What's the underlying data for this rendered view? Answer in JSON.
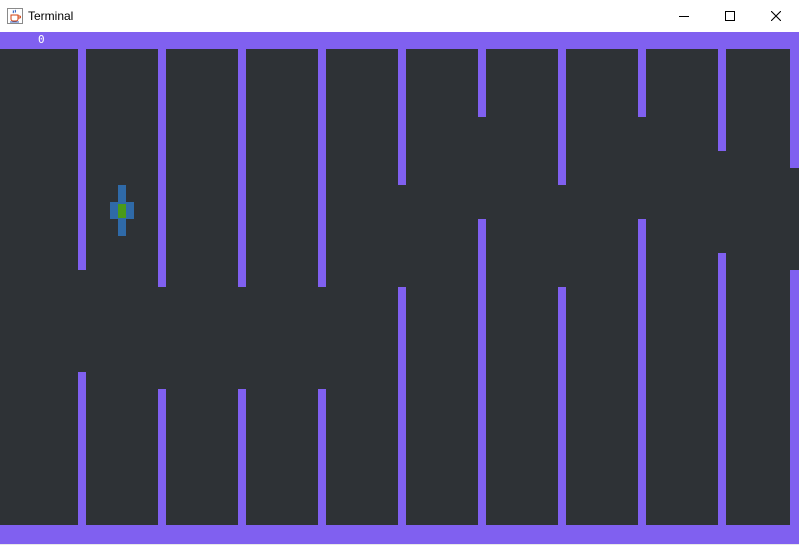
{
  "window": {
    "title": "Terminal",
    "icon": "java-cup-icon",
    "controls": [
      "minimize-icon",
      "maximize-icon",
      "close-icon"
    ]
  },
  "game": {
    "score": "0",
    "colors": {
      "background": "#2e3236",
      "wall": "#8060f0",
      "player_body": "#2f6aa8",
      "player_core": "#4a9a1a"
    }
  }
}
